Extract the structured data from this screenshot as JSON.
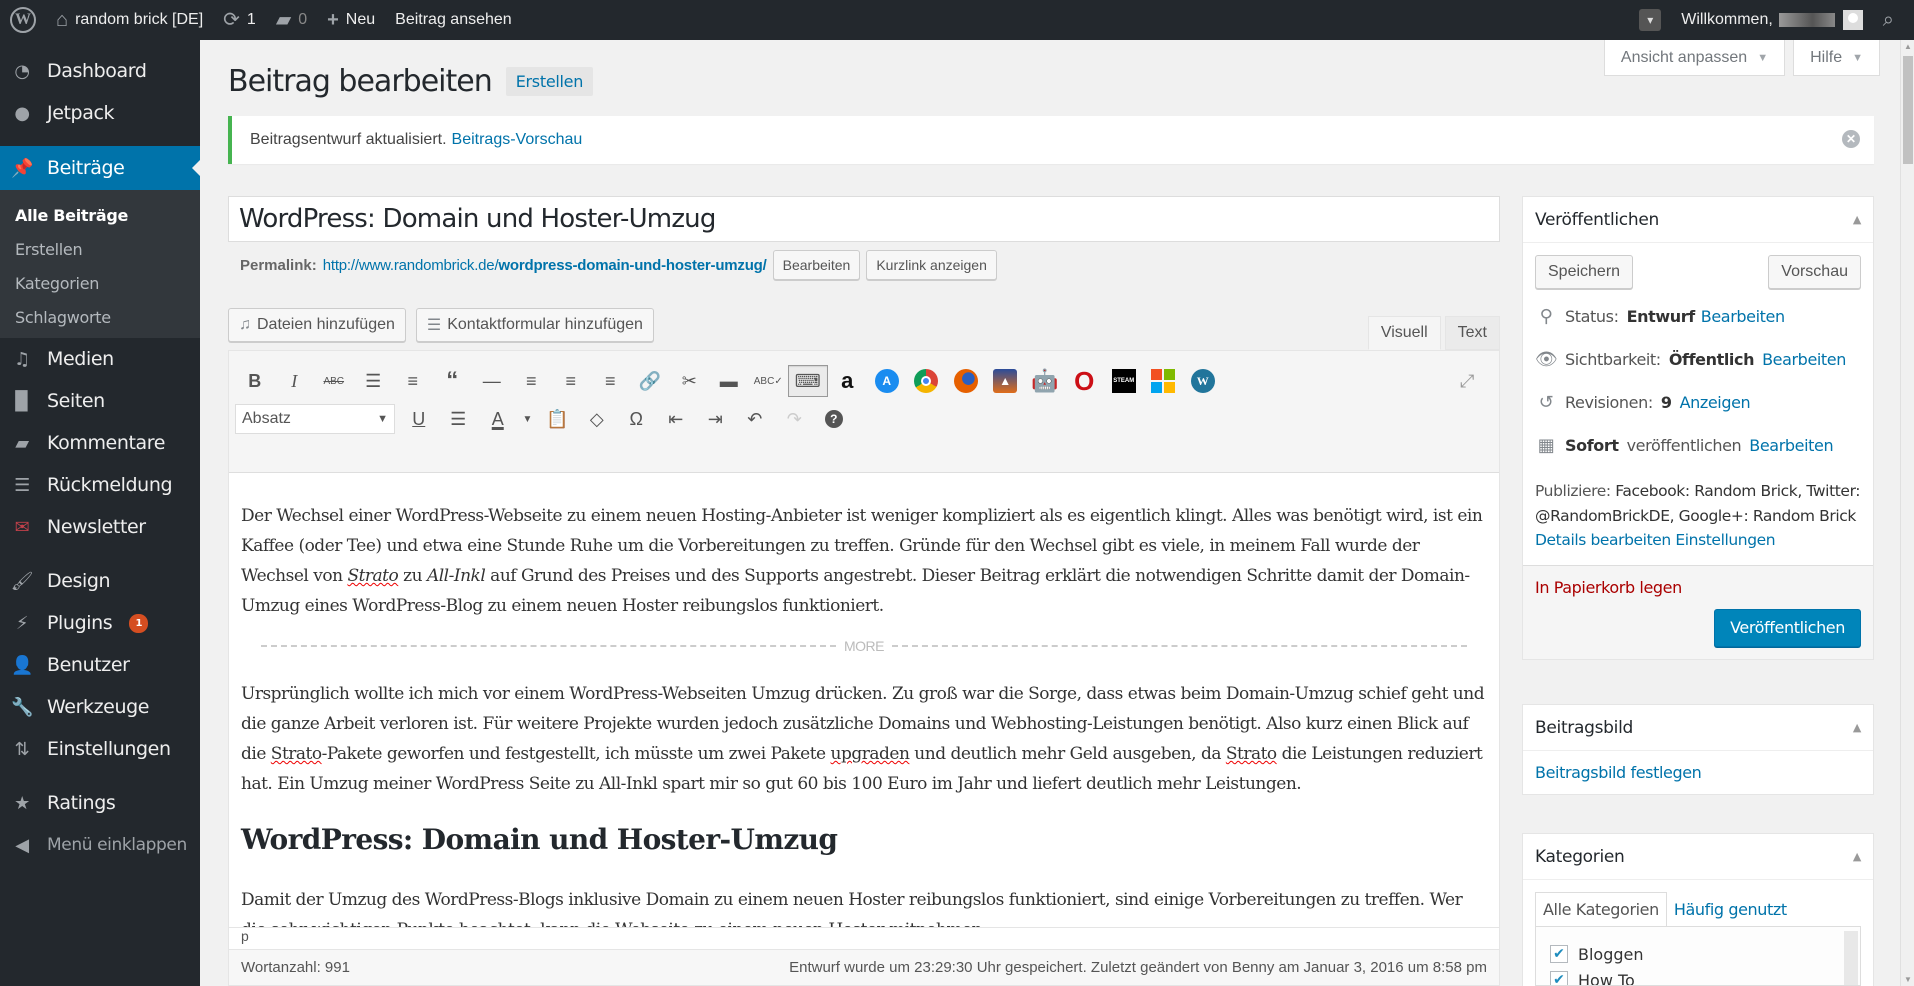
{
  "adminbar": {
    "wp_logo": "W",
    "site_name": "random brick [DE]",
    "updates_count": "1",
    "comments_count": "0",
    "new_label": "Neu",
    "view_post_label": "Beitrag ansehen",
    "welcome_label": "Willkommen,"
  },
  "sidebar": {
    "items": [
      {
        "label": "Dashboard",
        "icon": "dashboard-icon"
      },
      {
        "label": "Jetpack",
        "icon": "jetpack-icon"
      },
      {
        "label": "Beiträge",
        "icon": "pin-icon"
      },
      {
        "label": "Medien",
        "icon": "media-icon"
      },
      {
        "label": "Seiten",
        "icon": "pages-icon"
      },
      {
        "label": "Kommentare",
        "icon": "comment-icon"
      },
      {
        "label": "Rückmeldung",
        "icon": "feedback-icon"
      },
      {
        "label": "Newsletter",
        "icon": "mail-icon"
      },
      {
        "label": "Design",
        "icon": "brush-icon"
      },
      {
        "label": "Plugins",
        "icon": "plugin-icon",
        "badge": "1"
      },
      {
        "label": "Benutzer",
        "icon": "user-icon"
      },
      {
        "label": "Werkzeuge",
        "icon": "wrench-icon"
      },
      {
        "label": "Einstellungen",
        "icon": "settings-icon"
      },
      {
        "label": "Ratings",
        "icon": "star-icon"
      }
    ],
    "submenu": [
      "Alle Beiträge",
      "Erstellen",
      "Kategorien",
      "Schlagworte"
    ],
    "collapse_label": "Menü einklappen"
  },
  "screen_options": {
    "customize_label": "Ansicht anpassen",
    "help_label": "Hilfe"
  },
  "page": {
    "title": "Beitrag bearbeiten",
    "add_new_label": "Erstellen",
    "notice_text": "Beitragsentwurf aktualisiert.",
    "notice_link": "Beitrags-Vorschau"
  },
  "post": {
    "title": "WordPress: Domain und Hoster-Umzug",
    "permalink_label": "Permalink:",
    "permalink_base": "http://www.randombrick.de/",
    "permalink_slug": "wordpress-domain-und-hoster-umzug/",
    "edit_permalink_label": "Bearbeiten",
    "shortlink_label": "Kurzlink anzeigen"
  },
  "media_buttons": {
    "add_media": "Dateien hinzufügen",
    "add_contact_form": "Kontaktformular hinzufügen"
  },
  "editor_tabs": {
    "visual": "Visuell",
    "text": "Text"
  },
  "toolbar": {
    "format_select": "Absatz"
  },
  "content": {
    "p1_a": "Der Wechsel einer WordPress-Webseite zu einem neuen Hosting-Anbieter ist weniger kompliziert als es eigentlich klingt. Alles was benötigt wird, ist ein Kaffee (oder Tee) und etwa eine Stunde Ruhe um die Vorbereitungen zu treffen. Gründe für den Wechsel gibt es viele, in meinem Fall wurde der Wechsel von ",
    "p1_strato": "Strato",
    "p1_b": " zu ",
    "p1_allinkl": "All-Inkl",
    "p1_c": " auf Grund des Preises und des Supports angestrebt. Dieser Beitrag erklärt die notwendigen Schritte damit der Domain-Umzug eines WordPress-Blog zu einem neuen Hoster reibungslos funktioniert.",
    "more_label": "MORE",
    "p2_a": "Ursprünglich wollte ich mich vor einem WordPress-Webseiten Umzug drücken. Zu groß war die Sorge, dass etwas beim Domain-Umzug schief geht und die ganze Arbeit verloren ist. Für weitere Projekte wurden jedoch zusätzliche Domains und Webhosting-Leistungen benötigt. Also kurz einen Blick auf die ",
    "p2_strato1": "Strato",
    "p2_b": "-Pakete geworfen und festgestellt, ich müsste um zwei Pakete ",
    "p2_upgraden": "upgraden",
    "p2_c": " und deutlich mehr Geld ausgeben, da ",
    "p2_strato2": "Strato",
    "p2_d": " die Leistungen reduziert hat. Ein Umzug meiner WordPress Seite zu All-Inkl spart mir so gut 60 bis 100 Euro im Jahr und liefert deutlich mehr Leistungen.",
    "heading": "WordPress: Domain und Hoster-Umzug",
    "p3": "Damit der Umzug des WordPress-Blogs inklusive Domain zu einem neuen Hoster reibungslos funktioniert, sind einige Vorbereitungen zu treffen. Wer die sehr wichtigen Punkte beachtet, kann die Webseite zu einem neuen Hoster mitnehmen."
  },
  "statusbar": {
    "path": "p",
    "word_count": "Wortanzahl: 991",
    "autosave": "Entwurf wurde um 23:29:30 Uhr gespeichert. Zuletzt geändert von Benny am Januar 3, 2016 um 8:58 pm"
  },
  "publish_box": {
    "title": "Veröffentlichen",
    "save_label": "Speichern",
    "preview_label": "Vorschau",
    "status_label": "Status:",
    "status_value": "Entwurf",
    "visibility_label": "Sichtbarkeit:",
    "visibility_value": "Öffentlich",
    "revisions_label": "Revisionen:",
    "revisions_value": "9",
    "revisions_link": "Anzeigen",
    "schedule_value": "Sofort",
    "schedule_label": "veröffentlichen",
    "edit_link": "Bearbeiten",
    "publicize_label": "Publiziere:",
    "publicize_value": "Facebook: Random Brick, Twitter: @RandomBrickDE, Google+: Random Brick",
    "details_link": "Details bearbeiten",
    "settings_link": "Einstellungen",
    "trash_label": "In Papierkorb legen",
    "publish_label": "Veröffentlichen"
  },
  "featured_image_box": {
    "title": "Beitragsbild",
    "set_link": "Beitragsbild festlegen"
  },
  "categories_box": {
    "title": "Kategorien",
    "tab_all": "Alle Kategorien",
    "tab_popular": "Häufig genutzt",
    "items": [
      {
        "label": "Bloggen",
        "checked": true
      },
      {
        "label": "How To",
        "checked": true
      }
    ]
  }
}
